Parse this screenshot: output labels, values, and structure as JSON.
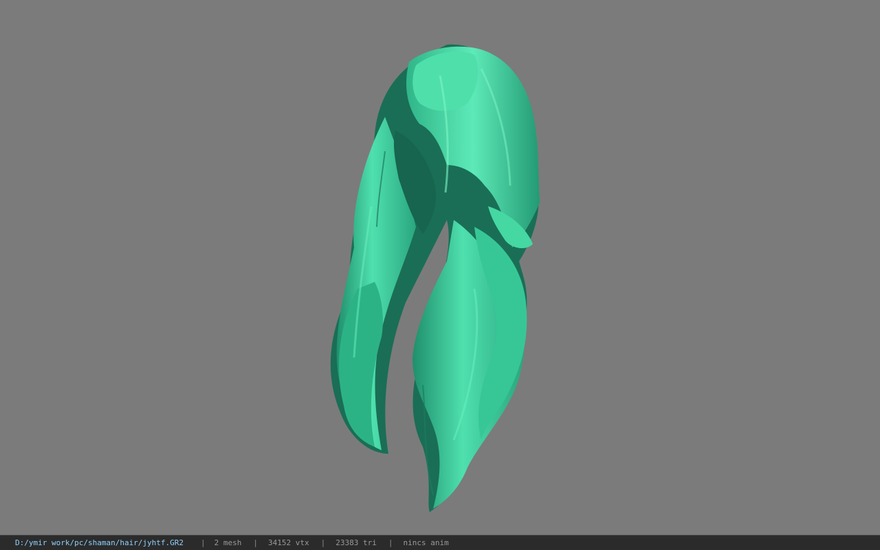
{
  "viewport": {
    "background_color": "#7b7b7b",
    "model": {
      "name": "hair-mesh",
      "color": "#3fcf9c"
    }
  },
  "statusbar": {
    "file_path": "D:/ymir work/pc/shaman/hair/jyhtf.GR2",
    "separator": "|",
    "mesh_count": "2 mesh",
    "vertex_count": "34152 vtx",
    "triangle_count": "23383 tri",
    "anim_status": "nincs anim"
  }
}
